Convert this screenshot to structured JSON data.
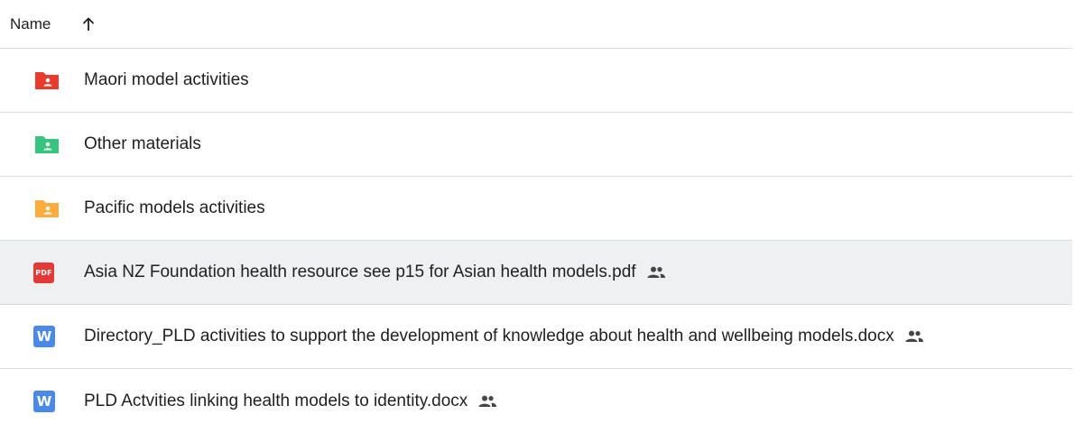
{
  "header": {
    "column_label": "Name",
    "sort_icon": "arrow-up-icon"
  },
  "files": [
    {
      "name": "Maori model activities",
      "type": "shared-folder",
      "color": "#ea3a2d",
      "shared": false
    },
    {
      "name": "Other materials",
      "type": "shared-folder",
      "color": "#37c47f",
      "shared": false
    },
    {
      "name": "Pacific models activities",
      "type": "shared-folder",
      "color": "#fbac3c",
      "shared": false
    },
    {
      "name": "Asia NZ Foundation health resource see p15 for Asian health models.pdf",
      "type": "pdf",
      "color": "#e53935",
      "icon_label": "PDF",
      "shared": true
    },
    {
      "name": "Directory_PLD activities to support the development of knowledge about health and wellbeing models.docx",
      "type": "docx",
      "color": "#4a88ea",
      "icon_label": "W",
      "shared": true
    },
    {
      "name": "PLD Actvities linking health models to identity.docx",
      "type": "docx",
      "color": "#4a88ea",
      "icon_label": "W",
      "shared": true
    }
  ]
}
